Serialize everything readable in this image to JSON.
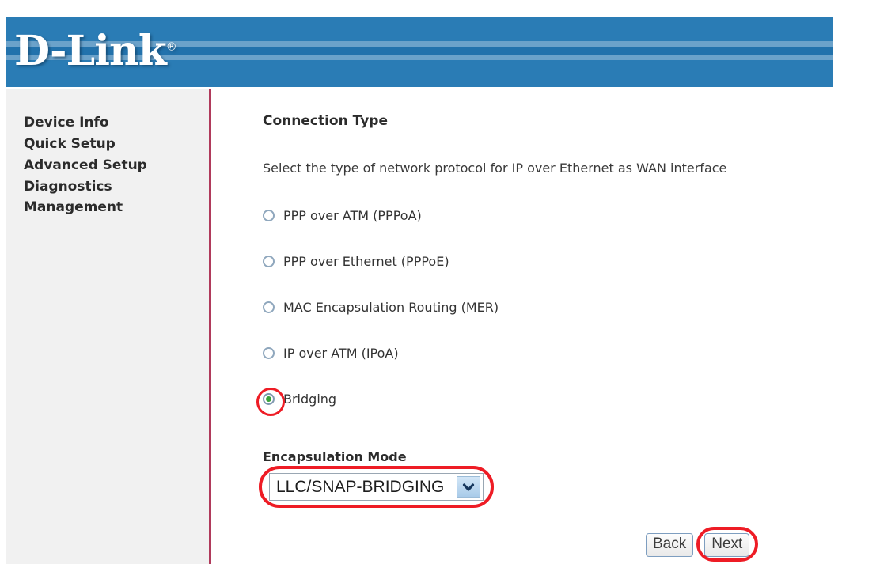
{
  "banner": {
    "logo_text": "D-Link",
    "registered_mark": "®",
    "background_color": "#2a7cb5",
    "stripe_color": "#6ba2ca"
  },
  "sidebar": {
    "items": [
      {
        "label": "Device Info"
      },
      {
        "label": "Quick Setup"
      },
      {
        "label": "Advanced Setup"
      },
      {
        "label": "Diagnostics"
      },
      {
        "label": "Management"
      }
    ],
    "divider_color": "#b03a5b",
    "background_color": "#f1f1f1"
  },
  "main": {
    "title": "Connection Type",
    "description": "Select the type of network protocol for IP over Ethernet as WAN interface",
    "connection_options": [
      {
        "label": "PPP over ATM (PPPoA)",
        "selected": false,
        "annotated": false
      },
      {
        "label": "PPP over Ethernet (PPPoE)",
        "selected": false,
        "annotated": false
      },
      {
        "label": "MAC Encapsulation Routing (MER)",
        "selected": false,
        "annotated": false
      },
      {
        "label": "IP over ATM (IPoA)",
        "selected": false,
        "annotated": false
      },
      {
        "label": "Bridging",
        "selected": true,
        "annotated": true
      }
    ],
    "encapsulation": {
      "label": "Encapsulation Mode",
      "selected_value": "LLC/SNAP-BRIDGING",
      "annotated": true
    },
    "buttons": {
      "back_label": "Back",
      "next_label": "Next",
      "next_annotated": true
    },
    "annotation_color": "#ee1c25",
    "selected_radio_dot_color": "#3aa33a"
  }
}
